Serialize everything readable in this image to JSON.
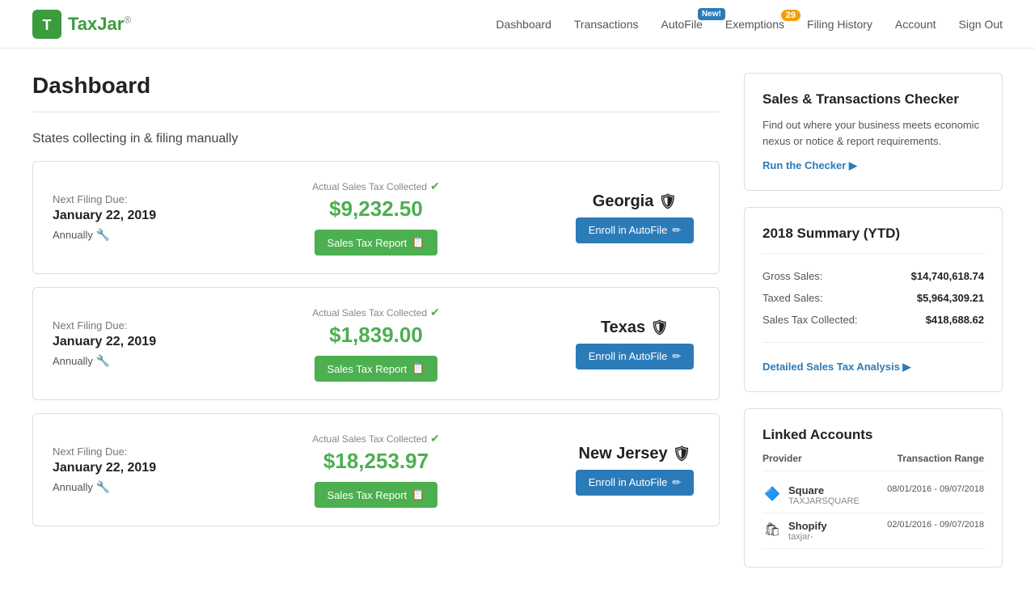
{
  "nav": {
    "logo_text": "TaxJar",
    "logo_sup": "®",
    "links": [
      {
        "label": "Dashboard",
        "href": "#",
        "badge": null
      },
      {
        "label": "Transactions",
        "href": "#",
        "badge": null
      },
      {
        "label": "AutoFile",
        "href": "#",
        "badge": "New!"
      },
      {
        "label": "Exemptions",
        "href": "#",
        "badge": "29"
      },
      {
        "label": "Filing History",
        "href": "#",
        "badge": null
      },
      {
        "label": "Account",
        "href": "#",
        "badge": null
      },
      {
        "label": "Sign Out",
        "href": "#",
        "badge": null
      }
    ]
  },
  "page": {
    "title": "Dashboard",
    "section_title": "States collecting in & filing manually"
  },
  "state_cards": [
    {
      "filing_due_label": "Next Filing Due:",
      "filing_date": "January 22, 2019",
      "frequency": "Annually",
      "tax_label": "Actual Sales Tax Collected",
      "tax_amount": "$9,232.50",
      "report_btn": "Sales Tax Report",
      "state_name": "Georgia",
      "autofile_btn": "Enroll in AutoFile"
    },
    {
      "filing_due_label": "Next Filing Due:",
      "filing_date": "January 22, 2019",
      "frequency": "Annually",
      "tax_label": "Actual Sales Tax Collected",
      "tax_amount": "$1,839.00",
      "report_btn": "Sales Tax Report",
      "state_name": "Texas",
      "autofile_btn": "Enroll in AutoFile"
    },
    {
      "filing_due_label": "Next Filing Due:",
      "filing_date": "January 22, 2019",
      "frequency": "Annually",
      "tax_label": "Actual Sales Tax Collected",
      "tax_amount": "$18,253.97",
      "report_btn": "Sales Tax Report",
      "state_name": "New Jersey",
      "autofile_btn": "Enroll in AutoFile"
    }
  ],
  "checker": {
    "title": "Sales & Transactions Checker",
    "description": "Find out where your business meets economic nexus or notice & report requirements.",
    "link_text": "Run the Checker ▶"
  },
  "summary": {
    "title": "2018 Summary (YTD)",
    "rows": [
      {
        "label": "Gross Sales:",
        "value": "$14,740,618.74"
      },
      {
        "label": "Taxed Sales:",
        "value": "$5,964,309.21"
      },
      {
        "label": "Sales Tax Collected:",
        "value": "$418,688.62"
      }
    ],
    "analysis_link": "Detailed Sales Tax Analysis ▶"
  },
  "linked_accounts": {
    "title": "Linked Accounts",
    "col_provider": "Provider",
    "col_range": "Transaction Range",
    "accounts": [
      {
        "icon": "🔷",
        "name": "Square",
        "sub": "TAXJARSQUARE",
        "range": "08/01/2016 - 09/07/2018"
      },
      {
        "icon": "🛍",
        "name": "Shopify",
        "sub": "taxjar-",
        "range": "02/01/2016 - 09/07/2018"
      }
    ]
  }
}
